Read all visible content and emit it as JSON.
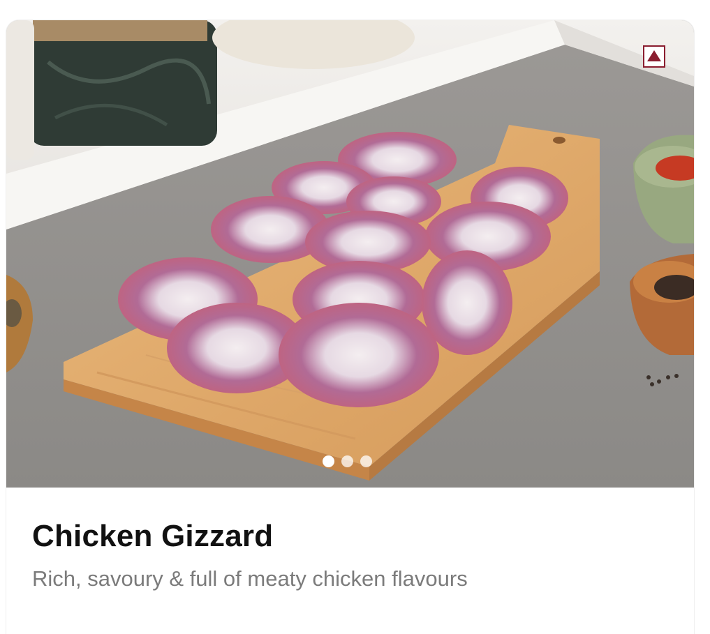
{
  "product": {
    "title": "Chicken Gizzard",
    "subtitle": "Rich, savoury & full of meaty chicken flavours"
  },
  "carousel": {
    "slide_count": 3,
    "active_index": 0
  },
  "badge": {
    "type": "non-veg",
    "color": "#8a1d2f"
  },
  "image": {
    "subject": "raw-chicken-gizzards-on-wooden-board"
  },
  "colors": {
    "title": "#111111",
    "subtitle": "#7b7b7b",
    "counter": "#8f8d8b",
    "board": "#e0a86a",
    "meat": "#c25a73"
  }
}
